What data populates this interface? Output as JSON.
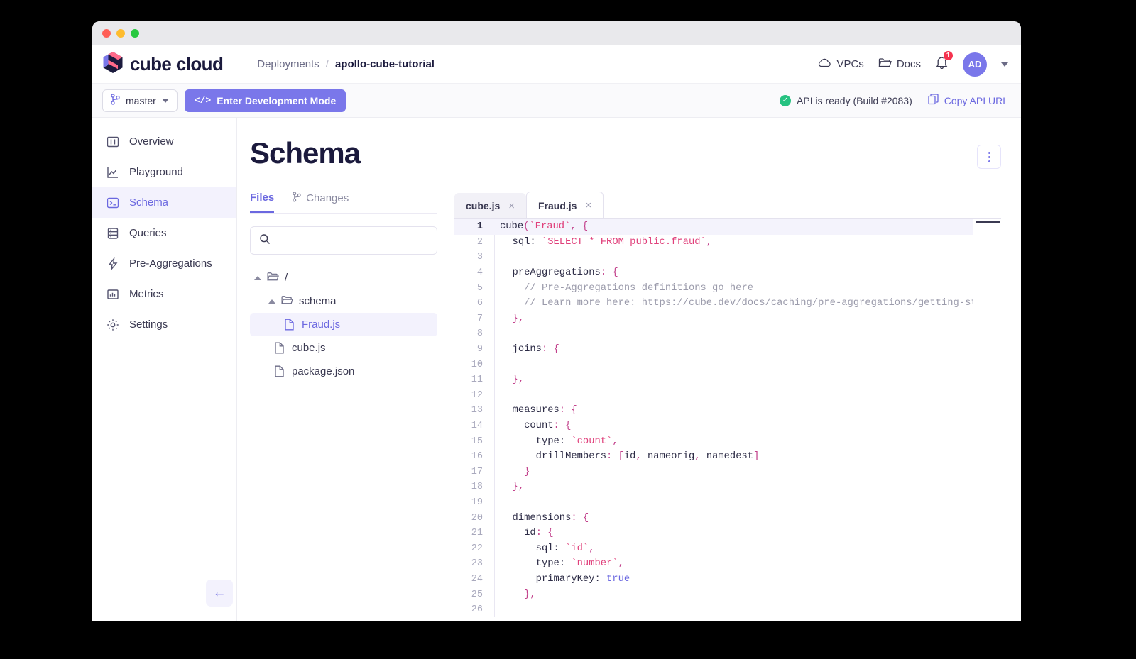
{
  "window": {
    "traffic_lights": [
      "#ff5f57",
      "#febc2e",
      "#28c840"
    ]
  },
  "header": {
    "brand": "cube cloud",
    "breadcrumb": {
      "parent": "Deployments",
      "separator": "/",
      "current": "apollo-cube-tutorial"
    },
    "vpcs_label": "VPCs",
    "docs_label": "Docs",
    "notification_count": "1",
    "avatar_initials": "AD"
  },
  "toolbar": {
    "branch": "master",
    "dev_mode_label": "Enter Development Mode",
    "dev_mode_glyph": "</>",
    "status_text": "API is ready (Build #2083)",
    "copy_api_label": "Copy API URL"
  },
  "sidebar": {
    "items": [
      {
        "label": "Overview",
        "icon": "dashboard-icon",
        "active": false
      },
      {
        "label": "Playground",
        "icon": "chart-line-icon",
        "active": false
      },
      {
        "label": "Schema",
        "icon": "terminal-icon",
        "active": true
      },
      {
        "label": "Queries",
        "icon": "server-icon",
        "active": false
      },
      {
        "label": "Pre-Aggregations",
        "icon": "bolt-icon",
        "active": false
      },
      {
        "label": "Metrics",
        "icon": "bar-chart-icon",
        "active": false
      },
      {
        "label": "Settings",
        "icon": "gear-icon",
        "active": false
      }
    ],
    "collapse_glyph": "←"
  },
  "page": {
    "title": "Schema"
  },
  "files_pane": {
    "tabs": [
      {
        "label": "Files",
        "active": true,
        "icon": null
      },
      {
        "label": "Changes",
        "active": false,
        "icon": "branch-icon"
      }
    ],
    "search": {
      "value": "",
      "placeholder": ""
    },
    "tree": [
      {
        "label": "/",
        "type": "folder",
        "depth": 0,
        "selected": false,
        "expanded": true
      },
      {
        "label": "schema",
        "type": "folder",
        "depth": 1,
        "selected": false,
        "expanded": true
      },
      {
        "label": "Fraud.js",
        "type": "file",
        "depth": 2,
        "selected": true,
        "expanded": false
      },
      {
        "label": "cube.js",
        "type": "file",
        "depth": 1,
        "selected": false,
        "expanded": false
      },
      {
        "label": "package.json",
        "type": "file",
        "depth": 1,
        "selected": false,
        "expanded": false
      }
    ]
  },
  "editor": {
    "tabs": [
      {
        "label": "cube.js",
        "active": false,
        "close": "×"
      },
      {
        "label": "Fraud.js",
        "active": true,
        "close": "×"
      }
    ],
    "active_line": 1,
    "lines": [
      {
        "n": 1,
        "tokens": [
          {
            "t": "cube",
            "c": "t-key"
          },
          {
            "t": "(",
            "c": "t-pun"
          },
          {
            "t": "`Fraud`",
            "c": "t-str"
          },
          {
            "t": ", {",
            "c": "t-pun"
          }
        ]
      },
      {
        "n": 2,
        "tokens": [
          {
            "t": "  sql: ",
            "c": "t-key"
          },
          {
            "t": "`SELECT * FROM public.fraud`",
            "c": "t-str"
          },
          {
            "t": ",",
            "c": "t-pun"
          }
        ]
      },
      {
        "n": 3,
        "tokens": []
      },
      {
        "n": 4,
        "tokens": [
          {
            "t": "  preAggregations",
            "c": "t-key"
          },
          {
            "t": ": {",
            "c": "t-pun"
          }
        ]
      },
      {
        "n": 5,
        "tokens": [
          {
            "t": "    // Pre-Aggregations definitions go here",
            "c": "t-com"
          }
        ]
      },
      {
        "n": 6,
        "tokens": [
          {
            "t": "    // Learn more here: ",
            "c": "t-com"
          },
          {
            "t": "https://cube.dev/docs/caching/pre-aggregations/getting-started",
            "c": "t-lnk"
          }
        ]
      },
      {
        "n": 7,
        "tokens": [
          {
            "t": "  },",
            "c": "t-pun"
          }
        ]
      },
      {
        "n": 8,
        "tokens": []
      },
      {
        "n": 9,
        "tokens": [
          {
            "t": "  joins",
            "c": "t-key"
          },
          {
            "t": ": {",
            "c": "t-pun"
          }
        ]
      },
      {
        "n": 10,
        "tokens": []
      },
      {
        "n": 11,
        "tokens": [
          {
            "t": "  },",
            "c": "t-pun"
          }
        ]
      },
      {
        "n": 12,
        "tokens": []
      },
      {
        "n": 13,
        "tokens": [
          {
            "t": "  measures",
            "c": "t-key"
          },
          {
            "t": ": {",
            "c": "t-pun"
          }
        ]
      },
      {
        "n": 14,
        "tokens": [
          {
            "t": "    count",
            "c": "t-key"
          },
          {
            "t": ": {",
            "c": "t-pun"
          }
        ]
      },
      {
        "n": 15,
        "tokens": [
          {
            "t": "      type: ",
            "c": "t-key"
          },
          {
            "t": "`count`",
            "c": "t-str"
          },
          {
            "t": ",",
            "c": "t-pun"
          }
        ]
      },
      {
        "n": 16,
        "tokens": [
          {
            "t": "      drillMembers",
            "c": "t-key"
          },
          {
            "t": ": [",
            "c": "t-pun"
          },
          {
            "t": "id",
            "c": "t-key"
          },
          {
            "t": ", ",
            "c": "t-pun"
          },
          {
            "t": "nameorig",
            "c": "t-key"
          },
          {
            "t": ", ",
            "c": "t-pun"
          },
          {
            "t": "namedest",
            "c": "t-key"
          },
          {
            "t": "]",
            "c": "t-pun"
          }
        ]
      },
      {
        "n": 17,
        "tokens": [
          {
            "t": "    }",
            "c": "t-pun"
          }
        ]
      },
      {
        "n": 18,
        "tokens": [
          {
            "t": "  },",
            "c": "t-pun"
          }
        ]
      },
      {
        "n": 19,
        "tokens": []
      },
      {
        "n": 20,
        "tokens": [
          {
            "t": "  dimensions",
            "c": "t-key"
          },
          {
            "t": ": {",
            "c": "t-pun"
          }
        ]
      },
      {
        "n": 21,
        "tokens": [
          {
            "t": "    id",
            "c": "t-key"
          },
          {
            "t": ": {",
            "c": "t-pun"
          }
        ]
      },
      {
        "n": 22,
        "tokens": [
          {
            "t": "      sql: ",
            "c": "t-key"
          },
          {
            "t": "`id`",
            "c": "t-str"
          },
          {
            "t": ",",
            "c": "t-pun"
          }
        ]
      },
      {
        "n": 23,
        "tokens": [
          {
            "t": "      type: ",
            "c": "t-key"
          },
          {
            "t": "`number`",
            "c": "t-str"
          },
          {
            "t": ",",
            "c": "t-pun"
          }
        ]
      },
      {
        "n": 24,
        "tokens": [
          {
            "t": "      primaryKey: ",
            "c": "t-key"
          },
          {
            "t": "true",
            "c": "t-bool"
          }
        ]
      },
      {
        "n": 25,
        "tokens": [
          {
            "t": "    },",
            "c": "t-pun"
          }
        ]
      },
      {
        "n": 26,
        "tokens": []
      }
    ]
  },
  "colors": {
    "accent": "#6b68e0",
    "accent_btn": "#7a77ea",
    "accent_soft": "#f3f2fd",
    "title_navy": "#1b1a3d",
    "status_green": "#26c281",
    "badge_red": "#f5334f",
    "string_pink": "#e0407b"
  }
}
